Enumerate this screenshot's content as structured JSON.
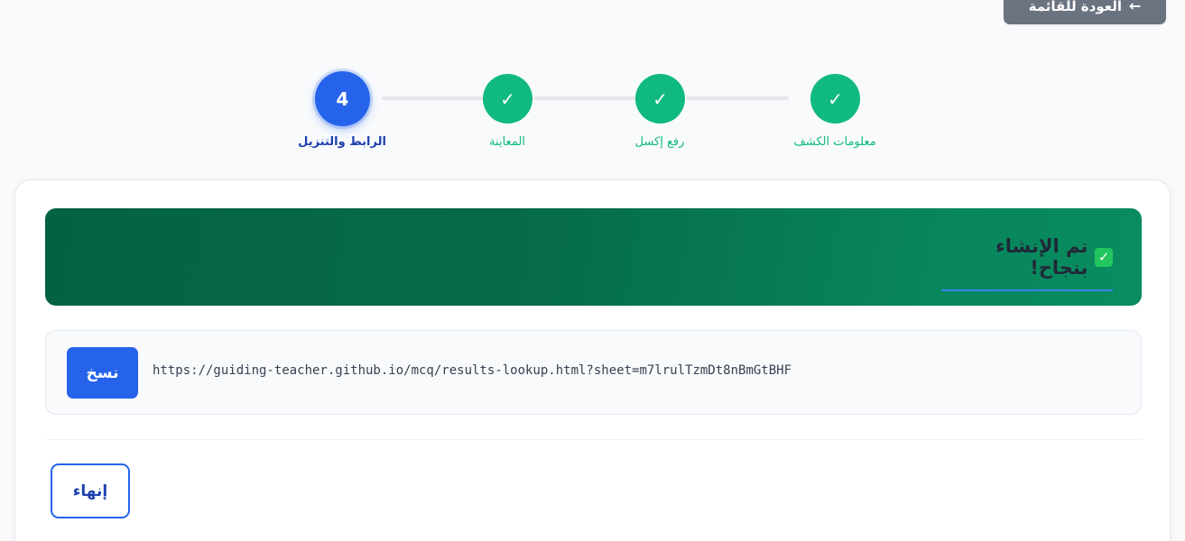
{
  "header": {
    "back_label": "العودة للقائمة",
    "back_arrow": "←"
  },
  "stepper": {
    "steps": [
      {
        "label": "معلومات الكشف",
        "state": "done",
        "mark": "✓"
      },
      {
        "label": "رفع إكسل",
        "state": "done",
        "mark": "✓"
      },
      {
        "label": "المعاينة",
        "state": "done",
        "mark": "✓"
      },
      {
        "label": "الرابط والتنزيل",
        "state": "active",
        "mark": "4"
      }
    ]
  },
  "result": {
    "check_mark": "✓",
    "success_title": "تم الإنشاء بنجاح!",
    "link_url": "https://guiding-teacher.github.io/mcq/results-lookup.html?sheet=m7lrulTzmDt8nBmGtBHF",
    "copy_label": "نسخ",
    "finish_label": "إنهاء"
  },
  "colors": {
    "primary": "#2563eb",
    "success": "#10b981",
    "banner_dark": "#046244",
    "banner_light": "#0a8c60",
    "neutral_button": "#6b7280"
  }
}
